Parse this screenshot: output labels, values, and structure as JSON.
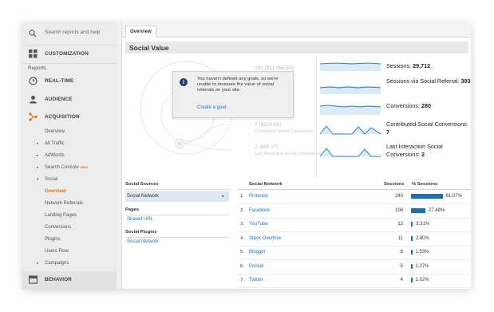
{
  "sidebar": {
    "search_placeholder": "Search reports and help",
    "customization": "CUSTOMIZATION",
    "reports_label": "Reports",
    "realtime": "REAL-TIME",
    "audience": "AUDIENCE",
    "acquisition": "ACQUISITION",
    "overview": "Overview",
    "all_traffic": "All Traffic",
    "adwords": "AdWords",
    "search_console": "Search Console",
    "new_badge": "NEW",
    "social": "Social",
    "social_overview": "Overview",
    "network_referrals": "Network Referrals",
    "landing_pages": "Landing Pages",
    "conversions": "Conversions",
    "plugins": "Plugins",
    "users_flow": "Users Flow",
    "campaigns": "Campaigns",
    "behavior": "BEHAVIOR"
  },
  "tab": {
    "overview": "Overview"
  },
  "page": {
    "title": "Social Value"
  },
  "funnel": {
    "top_value": "280 ($11,556.59)",
    "mid_value": "7 ($303.00)",
    "mid_label": "Contributed Social Conversions",
    "bottom_value": "2 ($88.37)",
    "bottom_label": "Last Interaction Social Conversions"
  },
  "popup": {
    "message": "You haven't defined any goals, so we're unable to measure the value of social referrals on your site.",
    "link": "Create a goal"
  },
  "metrics": [
    {
      "label": "Sessions:",
      "value": "29,712"
    },
    {
      "label": "Sessions via Social Referral:",
      "value": "393"
    },
    {
      "label": "Conversions:",
      "value": "280"
    },
    {
      "label": "Contributed Social Conversions:",
      "value": "7"
    },
    {
      "label": "Last Interaction Social Conversions:",
      "value": "2"
    }
  ],
  "left_panel": {
    "sources_header": "Social Sources",
    "social_network": "Social Network",
    "pages_header": "Pages",
    "shared_url": "Shared URL",
    "plugins_header": "Social Plugins",
    "plugins_network": "Social Network"
  },
  "table": {
    "headers": {
      "network": "Social Network",
      "sessions": "Sessions",
      "pct": "% Sessions"
    },
    "rows": [
      {
        "idx": "1.",
        "name": "Pinterest",
        "sessions": "240",
        "pct": "61.07%",
        "fraction": 0.6107
      },
      {
        "idx": "2.",
        "name": "Facebook",
        "sessions": "108",
        "pct": "27.48%",
        "fraction": 0.2748
      },
      {
        "idx": "3.",
        "name": "YouTube",
        "sessions": "13",
        "pct": "3.31%",
        "fraction": 0.0331
      },
      {
        "idx": "4.",
        "name": "Stack Overflow",
        "sessions": "11",
        "pct": "2.80%",
        "fraction": 0.028
      },
      {
        "idx": "5.",
        "name": "Blogger",
        "sessions": "6",
        "pct": "1.53%",
        "fraction": 0.0153
      },
      {
        "idx": "6.",
        "name": "Pocket",
        "sessions": "5",
        "pct": "1.27%",
        "fraction": 0.0127
      },
      {
        "idx": "7.",
        "name": "Twitter",
        "sessions": "4",
        "pct": "1.02%",
        "fraction": 0.0102
      }
    ]
  },
  "colors": {
    "accent": "#e37400",
    "link": "#1a73c8",
    "bar": "#1a6fb5",
    "spark": "#2f7ec4"
  }
}
